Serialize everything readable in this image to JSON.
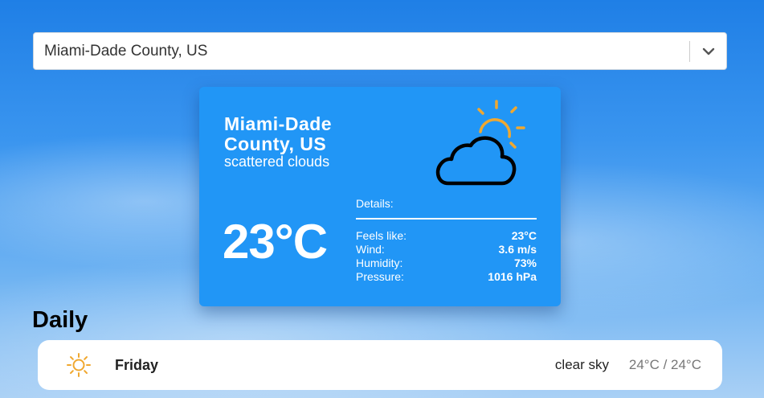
{
  "search": {
    "value": "Miami-Dade County, US"
  },
  "current": {
    "city": "Miami-Dade County, US",
    "description": "scattered clouds",
    "temperature": "23°C",
    "icon": "partly-cloudy-icon",
    "details_title": "Details:",
    "details": [
      {
        "label": "Feels like:",
        "value": "23°C"
      },
      {
        "label": "Wind:",
        "value": "3.6 m/s"
      },
      {
        "label": "Humidity:",
        "value": "73%"
      },
      {
        "label": "Pressure:",
        "value": "1016 hPa"
      }
    ]
  },
  "daily": {
    "heading": "Daily",
    "items": [
      {
        "day": "Friday",
        "description": "clear sky",
        "temps": "24°C / 24°C",
        "icon": "sun-icon"
      }
    ]
  },
  "colors": {
    "card_bg": "#2196f6",
    "sun": "#f0a830"
  }
}
